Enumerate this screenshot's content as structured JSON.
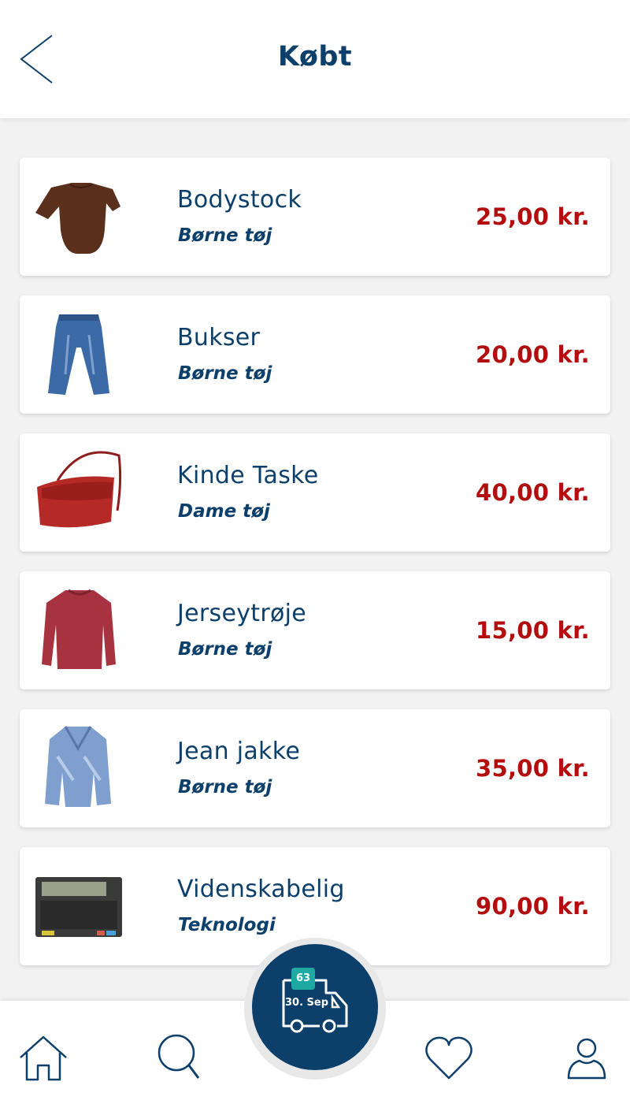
{
  "header": {
    "title": "Købt"
  },
  "items": [
    {
      "name": "Bodystock",
      "category": "Børne tøj",
      "price": "25,00 kr.",
      "image": "brown-baby-bodysuit"
    },
    {
      "name": "Bukser",
      "category": "Børne tøj",
      "price": "20,00 kr.",
      "image": "blue-jeans"
    },
    {
      "name": "Kinde Taske",
      "category": "Dame tøj",
      "price": "40,00 kr.",
      "image": "red-handbag"
    },
    {
      "name": "Jerseytrøje",
      "category": "Børne tøj",
      "price": "15,00 kr.",
      "image": "red-sweater"
    },
    {
      "name": "Jean jakke",
      "category": "Børne tøj",
      "price": "35,00 kr.",
      "image": "denim-jacket"
    },
    {
      "name": "Videnskabelig",
      "category": "Teknologi",
      "price": "90,00 kr.",
      "image": "calculator-keyboard"
    }
  ],
  "delivery": {
    "badge": "63",
    "date": "30. Sep"
  },
  "tabbar": {
    "items": [
      "home-icon",
      "search-icon",
      "heart-icon",
      "user-icon"
    ]
  },
  "colors": {
    "primary": "#0d3f6b",
    "price": "#b30e0e",
    "badge": "#1fa9a3"
  }
}
